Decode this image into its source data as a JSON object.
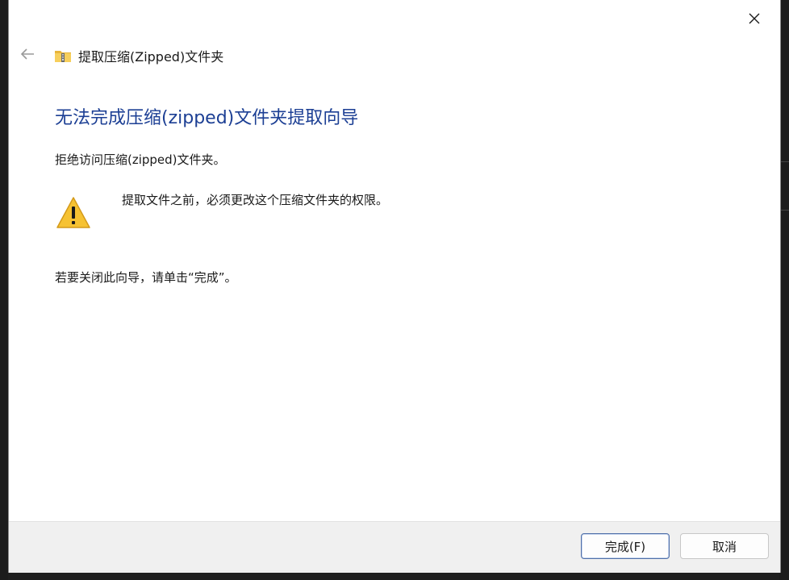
{
  "window": {
    "title": "提取压缩(Zipped)文件夹",
    "close_icon": "close-icon",
    "back_icon": "back-arrow-icon"
  },
  "main": {
    "heading": "无法完成压缩(zipped)文件夹提取向导",
    "description": "拒绝访问压缩(zipped)文件夹。",
    "warning_text": "提取文件之前，必须更改这个压缩文件夹的权限。",
    "close_hint": "若要关闭此向导，请单击“完成”。"
  },
  "footer": {
    "finish_label": "完成(F)",
    "cancel_label": "取消"
  },
  "colors": {
    "heading": "#1c3f94",
    "warning_fill": "#f6c232",
    "footer_bg": "#f0f0f0"
  }
}
